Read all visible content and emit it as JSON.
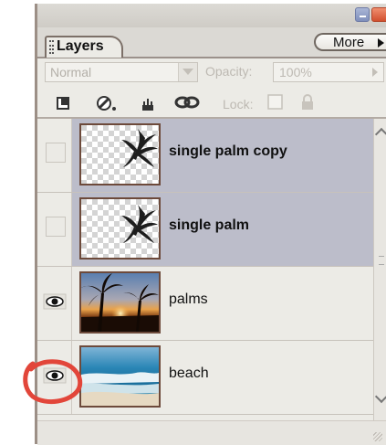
{
  "panel": {
    "tab_label": "Layers",
    "more_label": "More",
    "blend_mode": "Normal",
    "opacity_label": "Opacity:",
    "opacity_value": "100%",
    "lock_label": "Lock:"
  },
  "layers": [
    {
      "name": "single palm copy",
      "visible": false,
      "selected": true,
      "thumbnail": "single-palm-transparent"
    },
    {
      "name": "single palm",
      "visible": false,
      "selected": true,
      "thumbnail": "single-palm-transparent"
    },
    {
      "name": "palms",
      "visible": true,
      "selected": false,
      "thumbnail": "palms-sunset"
    },
    {
      "name": "beach",
      "visible": true,
      "selected": false,
      "thumbnail": "beach-ocean"
    }
  ],
  "colors": {
    "selected_row": "#bcbdca",
    "highlight_circle": "#e2463a",
    "panel_bg": "#ecebe6"
  },
  "icons": [
    "new-layer-icon",
    "brush-icon",
    "lock-move-icon",
    "link-icon",
    "checkbox-icon",
    "padlock-icon",
    "eye-icon"
  ]
}
